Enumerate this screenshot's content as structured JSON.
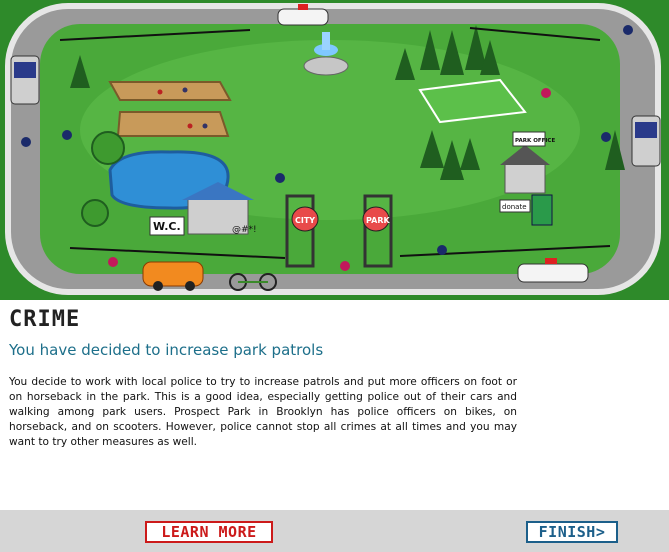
{
  "scene": {
    "signs": {
      "wc": "W.C.",
      "city": "CITY",
      "park": "PARK",
      "park_office": "PARK OFFICE",
      "donate": "donate",
      "speech": "@#*!"
    }
  },
  "section_title": "CRIME",
  "decision_heading": "You have decided to increase park patrols",
  "body_text": "You decide to work with local police to try to increase patrols and put more officers on foot or on horseback in the park. This is a good idea, especially getting police out of their cars and walking among park users. Prospect Park in Brooklyn has police officers on bikes, on horseback, and on scooters. However, police cannot stop all crimes at all times and you may want to try other measures as well.",
  "buttons": {
    "learn_more": "LEARN MORE",
    "finish": "FINISH>"
  }
}
